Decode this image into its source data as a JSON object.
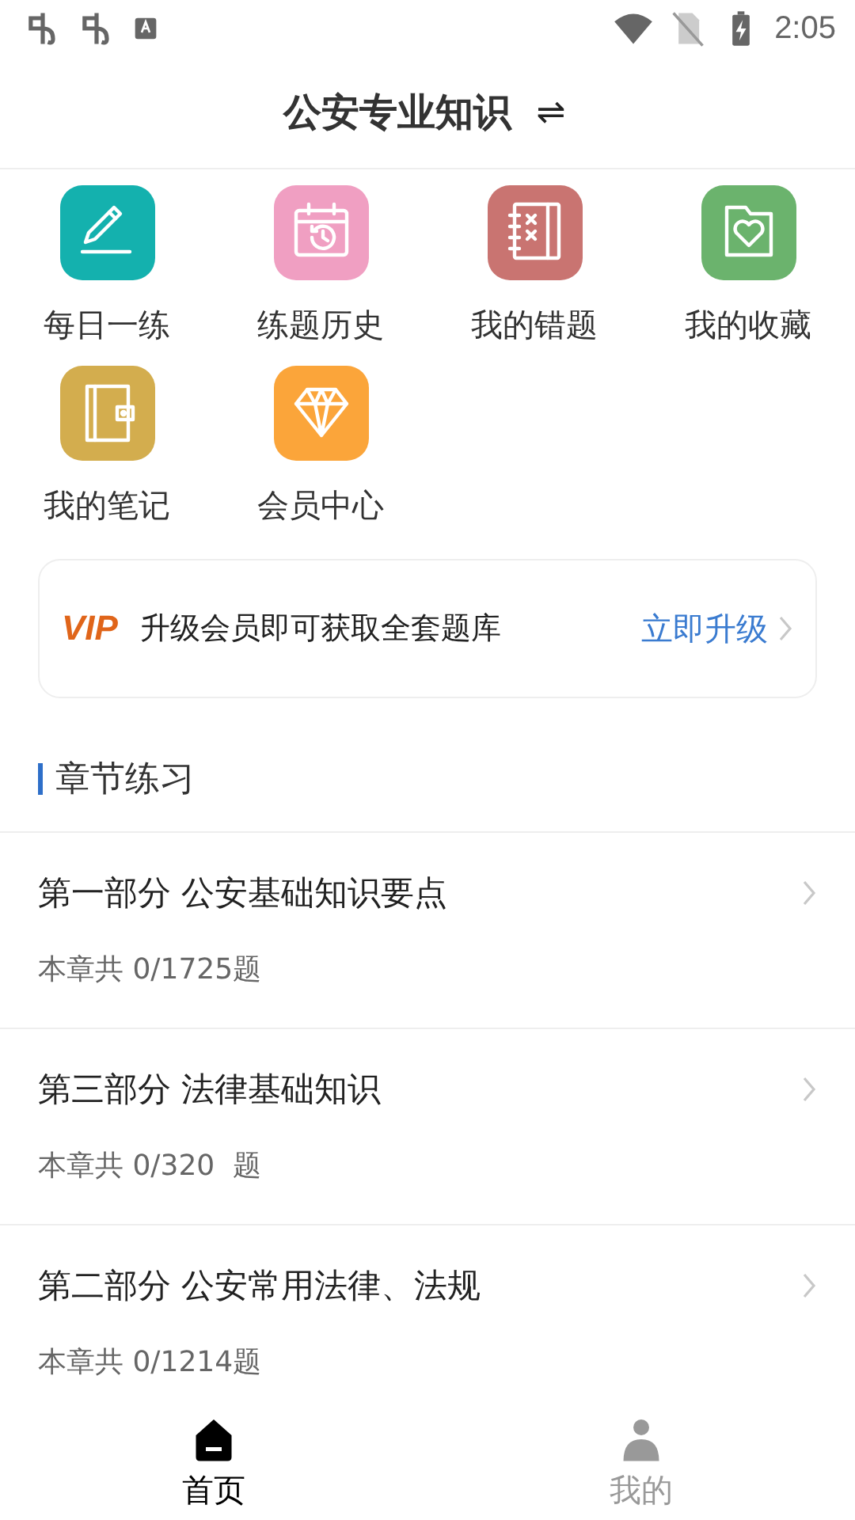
{
  "status_bar": {
    "time": "2:05"
  },
  "header": {
    "title": "公安专业知识",
    "switch": "⇌"
  },
  "shortcuts": [
    {
      "label": "每日一练",
      "kind": "pencil",
      "color": "#14b1ae"
    },
    {
      "label": "练题历史",
      "kind": "calendar",
      "color": "#f09fc2"
    },
    {
      "label": "我的错题",
      "kind": "notebook",
      "color": "#c97471"
    },
    {
      "label": "我的收藏",
      "kind": "folder",
      "color": "#6bb36d"
    },
    {
      "label": "我的笔记",
      "kind": "wallet",
      "color": "#d3ad4e"
    },
    {
      "label": "会员中心",
      "kind": "diamond",
      "color": "#fba53a"
    }
  ],
  "vip_banner": {
    "badge": "VIP",
    "text": "升级会员即可获取全套题库",
    "action": "立即升级"
  },
  "section": {
    "title": "章节练习"
  },
  "chapters": [
    {
      "title": "第一部分 公安基础知识要点",
      "subtitle": "本章共 0/1725题"
    },
    {
      "title": "第三部分 法律基础知识",
      "subtitle": "本章共 0/320  题"
    },
    {
      "title": "第二部分 公安常用法律、法规",
      "subtitle": "本章共 0/1214题"
    }
  ],
  "bottom_nav": [
    {
      "label": "首页",
      "kind": "home",
      "selected": true
    },
    {
      "label": "我的",
      "kind": "person",
      "selected": false
    }
  ]
}
